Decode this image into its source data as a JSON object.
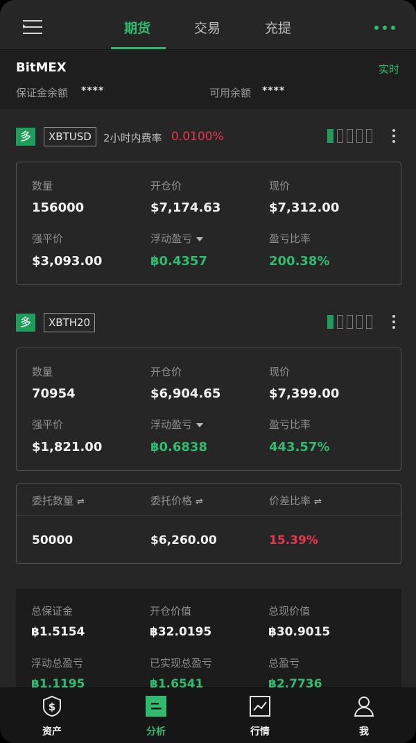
{
  "nav": {
    "tabs": [
      {
        "label": "期货"
      },
      {
        "label": "交易"
      },
      {
        "label": "充提"
      }
    ]
  },
  "account": {
    "exchange": "BitMEX",
    "mode": "实时",
    "margin_label": "保证金余额",
    "margin_value": "****",
    "available_label": "可用余额",
    "available_value": "****"
  },
  "positions": [
    {
      "side": "多",
      "symbol": "XBTUSD",
      "funding_label": "2小时内费率",
      "funding_rate": "0.0100%",
      "leverage_filled": 1,
      "leverage_total": 5,
      "qty_label": "数量",
      "qty": "156000",
      "entry_label": "开仓价",
      "entry": "$7,174.63",
      "mark_label": "现价",
      "mark": "$7,312.00",
      "liq_label": "强平价",
      "liq": "$3,093.00",
      "pnl_label": "浮动盈亏",
      "pnl": "฿0.4357",
      "roe_label": "盈亏比率",
      "roe": "200.38%"
    },
    {
      "side": "多",
      "symbol": "XBTH20",
      "leverage_filled": 1,
      "leverage_total": 5,
      "qty_label": "数量",
      "qty": "70954",
      "entry_label": "开仓价",
      "entry": "$6,904.65",
      "mark_label": "现价",
      "mark": "$7,399.00",
      "liq_label": "强平价",
      "liq": "$1,821.00",
      "pnl_label": "浮动盈亏",
      "pnl": "฿0.6838",
      "roe_label": "盈亏比率",
      "roe": "443.57%"
    }
  ],
  "order": {
    "qty_label": "委托数量",
    "price_label": "委托价格",
    "spread_label": "价差比率",
    "qty": "50000",
    "price": "$6,260.00",
    "spread": "15.39%"
  },
  "summary": {
    "total_margin_label": "总保证金",
    "total_margin": "฿1.5154",
    "entry_value_label": "开仓价值",
    "entry_value": "฿32.0195",
    "mark_value_label": "总现价值",
    "mark_value": "฿30.9015",
    "unrealized_label": "浮动总盈亏",
    "unrealized": "฿1.1195",
    "realized_label": "已实现总盈亏",
    "realized": "฿1.6541",
    "total_pnl_label": "总盈亏",
    "total_pnl": "฿2.7736"
  },
  "bottom_nav": [
    {
      "label": "资产",
      "icon": "dollar-shield-icon"
    },
    {
      "label": "分析",
      "icon": "analysis-icon"
    },
    {
      "label": "行情",
      "icon": "chart-icon"
    },
    {
      "label": "我",
      "icon": "user-icon"
    }
  ],
  "colors": {
    "accent": "#2ebd6e",
    "negative": "#e8374e",
    "background": "#262626"
  }
}
